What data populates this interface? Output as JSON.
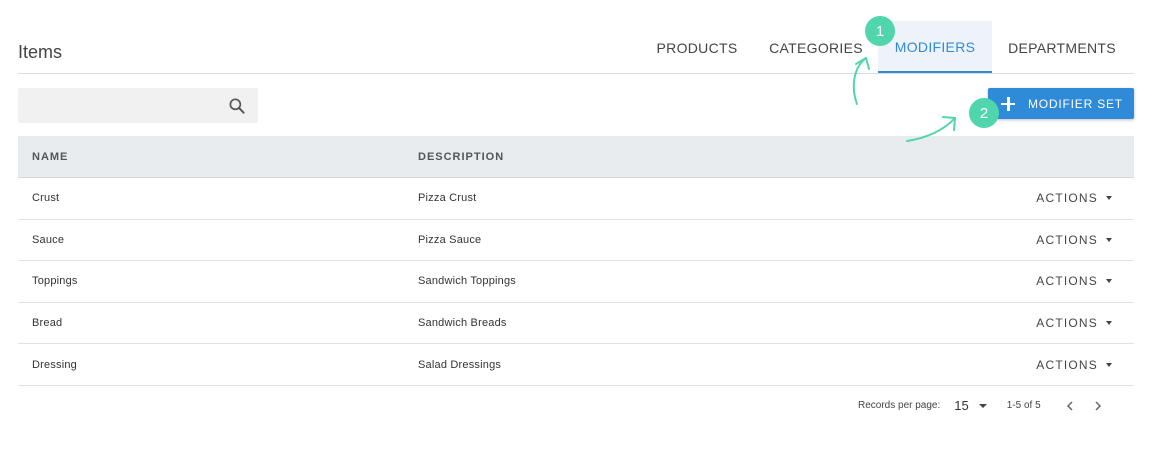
{
  "header": {
    "title": "Items"
  },
  "tabs": [
    {
      "label": "PRODUCTS",
      "active": false
    },
    {
      "label": "CATEGORIES",
      "active": false
    },
    {
      "label": "MODIFIERS",
      "active": true
    },
    {
      "label": "DEPARTMENTS",
      "active": false
    }
  ],
  "search": {
    "value": "",
    "placeholder": "",
    "icon": "search-icon"
  },
  "toolbar": {
    "add_label": "MODIFIER SET",
    "add_icon": "plus-icon"
  },
  "table": {
    "columns": [
      "NAME",
      "DESCRIPTION"
    ],
    "rows": [
      {
        "name": "Crust",
        "description": "Pizza Crust",
        "actions": "ACTIONS"
      },
      {
        "name": "Sauce",
        "description": "Pizza Sauce",
        "actions": "ACTIONS"
      },
      {
        "name": "Toppings",
        "description": "Sandwich Toppings",
        "actions": "ACTIONS"
      },
      {
        "name": "Bread",
        "description": "Sandwich Breads",
        "actions": "ACTIONS"
      },
      {
        "name": "Dressing",
        "description": "Salad Dressings",
        "actions": "ACTIONS"
      }
    ]
  },
  "pagination": {
    "label": "Records per page:",
    "page_size": "15",
    "range": "1-5 of 5",
    "prev_icon": "chevron-left-icon",
    "next_icon": "chevron-right-icon"
  },
  "annotations": [
    {
      "number": "1",
      "color": "#4fd6ad"
    },
    {
      "number": "2",
      "color": "#4fd6ad"
    }
  ],
  "colors": {
    "accent": "#2f8ad8",
    "annotation": "#4fd6ad",
    "header_bg": "#e9ecef"
  }
}
